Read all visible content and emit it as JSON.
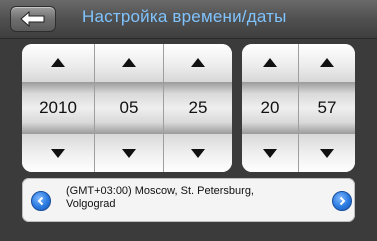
{
  "header": {
    "title": "Настройка времени/даты",
    "back_icon": "back-arrow-icon"
  },
  "date": {
    "year": "2010",
    "month": "05",
    "day": "25"
  },
  "time": {
    "hour": "20",
    "minute": "57"
  },
  "timezone": {
    "label_line1": "(GMT+03:00) Moscow, St. Petersburg,",
    "label_line2": "Volgograd",
    "prev_icon": "chevron-left-icon",
    "next_icon": "chevron-right-icon"
  },
  "colors": {
    "title": "#7fc3ff",
    "accent_button": "#2a7ae0"
  }
}
